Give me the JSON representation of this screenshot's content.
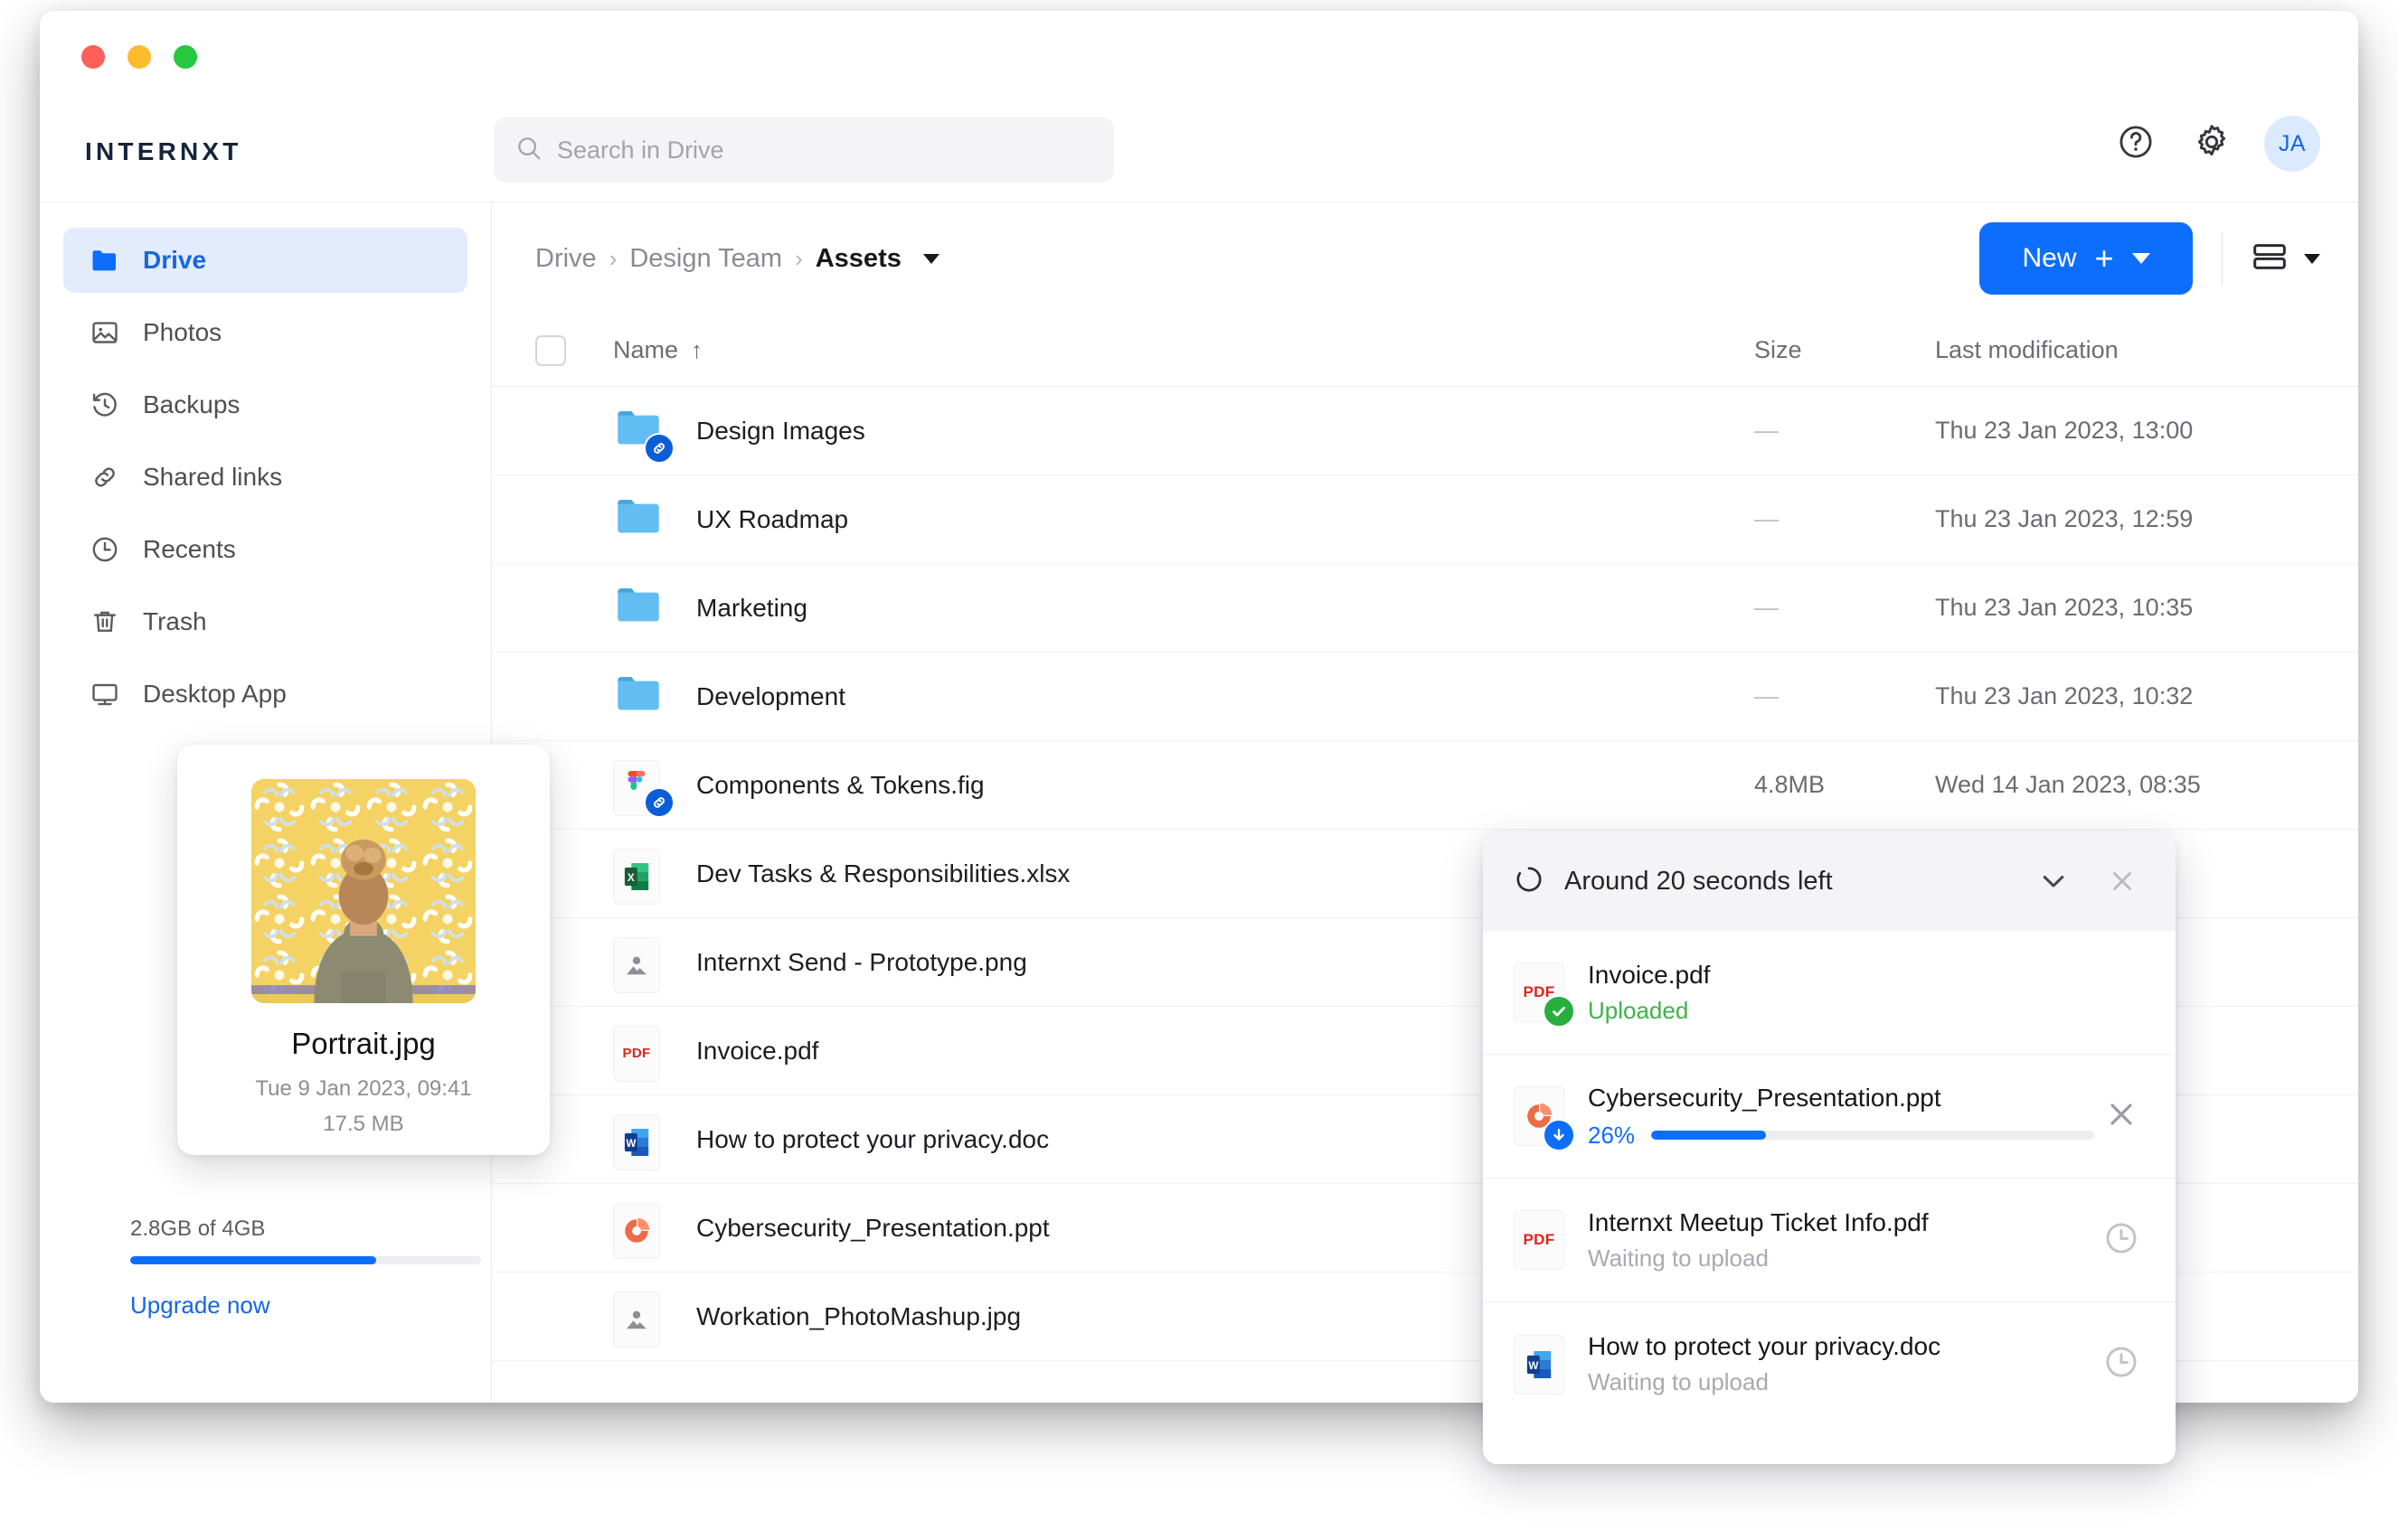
{
  "window": {
    "traffic_lights": [
      "close",
      "minimize",
      "maximize"
    ],
    "colors": {
      "close": "#fc6058",
      "minimize": "#fdbc2c",
      "maximize": "#25c83f",
      "accent": "#0d6efd",
      "link": "#1667e0",
      "success": "#3eb24a"
    }
  },
  "topbar": {
    "brand": "INTERNXT",
    "search": {
      "placeholder": "Search in Drive",
      "value": ""
    },
    "help_icon": "question-circle-icon",
    "settings_icon": "gear-icon",
    "avatar_initials": "JA"
  },
  "sidebar": {
    "items": [
      {
        "label": "Drive",
        "icon": "folder-icon",
        "active": true
      },
      {
        "label": "Photos",
        "icon": "image-icon",
        "active": false
      },
      {
        "label": "Backups",
        "icon": "history-icon",
        "active": false
      },
      {
        "label": "Shared links",
        "icon": "link-icon",
        "active": false
      },
      {
        "label": "Recents",
        "icon": "clock-icon",
        "active": false
      },
      {
        "label": "Trash",
        "icon": "trash-icon",
        "active": false
      },
      {
        "label": "Desktop App",
        "icon": "monitor-icon",
        "active": false
      }
    ],
    "storage": {
      "text": "2.8GB of 4GB",
      "used_percent": 70,
      "upgrade_label": "Upgrade now"
    }
  },
  "breadcrumb": {
    "items": [
      "Drive",
      "Design Team",
      "Assets"
    ],
    "separator": "›",
    "current_index": 2
  },
  "toolbar": {
    "new_label": "New",
    "new_plus": "+",
    "view_icon": "list-view-icon"
  },
  "table": {
    "columns": {
      "name": "Name",
      "size": "Size",
      "modified": "Last modification"
    },
    "sort_arrow": "↑",
    "rows": [
      {
        "name": "Design Images",
        "type": "folder",
        "shared": true,
        "size": "—",
        "modified": "Thu 23 Jan 2023, 13:00"
      },
      {
        "name": "UX Roadmap",
        "type": "folder",
        "shared": false,
        "size": "—",
        "modified": "Thu 23 Jan 2023, 12:59"
      },
      {
        "name": "Marketing",
        "type": "folder",
        "shared": false,
        "size": "—",
        "modified": "Thu 23 Jan 2023, 10:35"
      },
      {
        "name": "Development",
        "type": "folder",
        "shared": false,
        "size": "—",
        "modified": "Thu 23 Jan 2023, 10:32"
      },
      {
        "name": "Components & Tokens.fig",
        "type": "figma",
        "shared": true,
        "size": "4.8MB",
        "modified": "Wed 14 Jan 2023, 08:35"
      },
      {
        "name": "Dev Tasks & Responsibilities.xlsx",
        "type": "excel",
        "shared": false,
        "size": "",
        "modified": ""
      },
      {
        "name": "Internxt Send - Prototype.png",
        "type": "image",
        "shared": false,
        "size": "",
        "modified": ""
      },
      {
        "name": "Invoice.pdf",
        "type": "pdf",
        "shared": false,
        "size": "",
        "modified": ""
      },
      {
        "name": "How to protect your privacy.doc",
        "type": "word",
        "shared": false,
        "size": "",
        "modified": ""
      },
      {
        "name": "Cybersecurity_Presentation.ppt",
        "type": "powerpoint",
        "shared": false,
        "size": "",
        "modified": ""
      },
      {
        "name": "Workation_PhotoMashup.jpg",
        "type": "image",
        "shared": false,
        "size": "",
        "modified": ""
      }
    ]
  },
  "preview_card": {
    "filename": "Portrait.jpg",
    "date": "Tue 9 Jan 2023, 09:41",
    "size": "17.5 MB",
    "thumbnail": "portrait-photo-woman-yellow-tiles"
  },
  "upload_toast": {
    "title": "Around 20 seconds left",
    "spinner_icon": "loading-spinner-icon",
    "collapse_icon": "chevron-down-icon",
    "close_icon": "close-icon",
    "items": [
      {
        "name": "Invoice.pdf",
        "type": "pdf",
        "state": "uploaded",
        "status_text": "Uploaded",
        "percent": 100,
        "badge": "check-badge",
        "action": "none"
      },
      {
        "name": "Cybersecurity_Presentation.ppt",
        "type": "powerpoint",
        "state": "uploading",
        "status_text": "",
        "percent": 26,
        "percent_label": "26%",
        "badge": "download-badge",
        "action": "cancel"
      },
      {
        "name": "Internxt Meetup Ticket Info.pdf",
        "type": "pdf",
        "state": "waiting",
        "status_text": "Waiting to upload",
        "percent": 0,
        "badge": "none",
        "action": "clock"
      },
      {
        "name": "How to protect your privacy.doc",
        "type": "word",
        "state": "waiting",
        "status_text": "Waiting to upload",
        "percent": 0,
        "badge": "none",
        "action": "clock"
      }
    ]
  }
}
